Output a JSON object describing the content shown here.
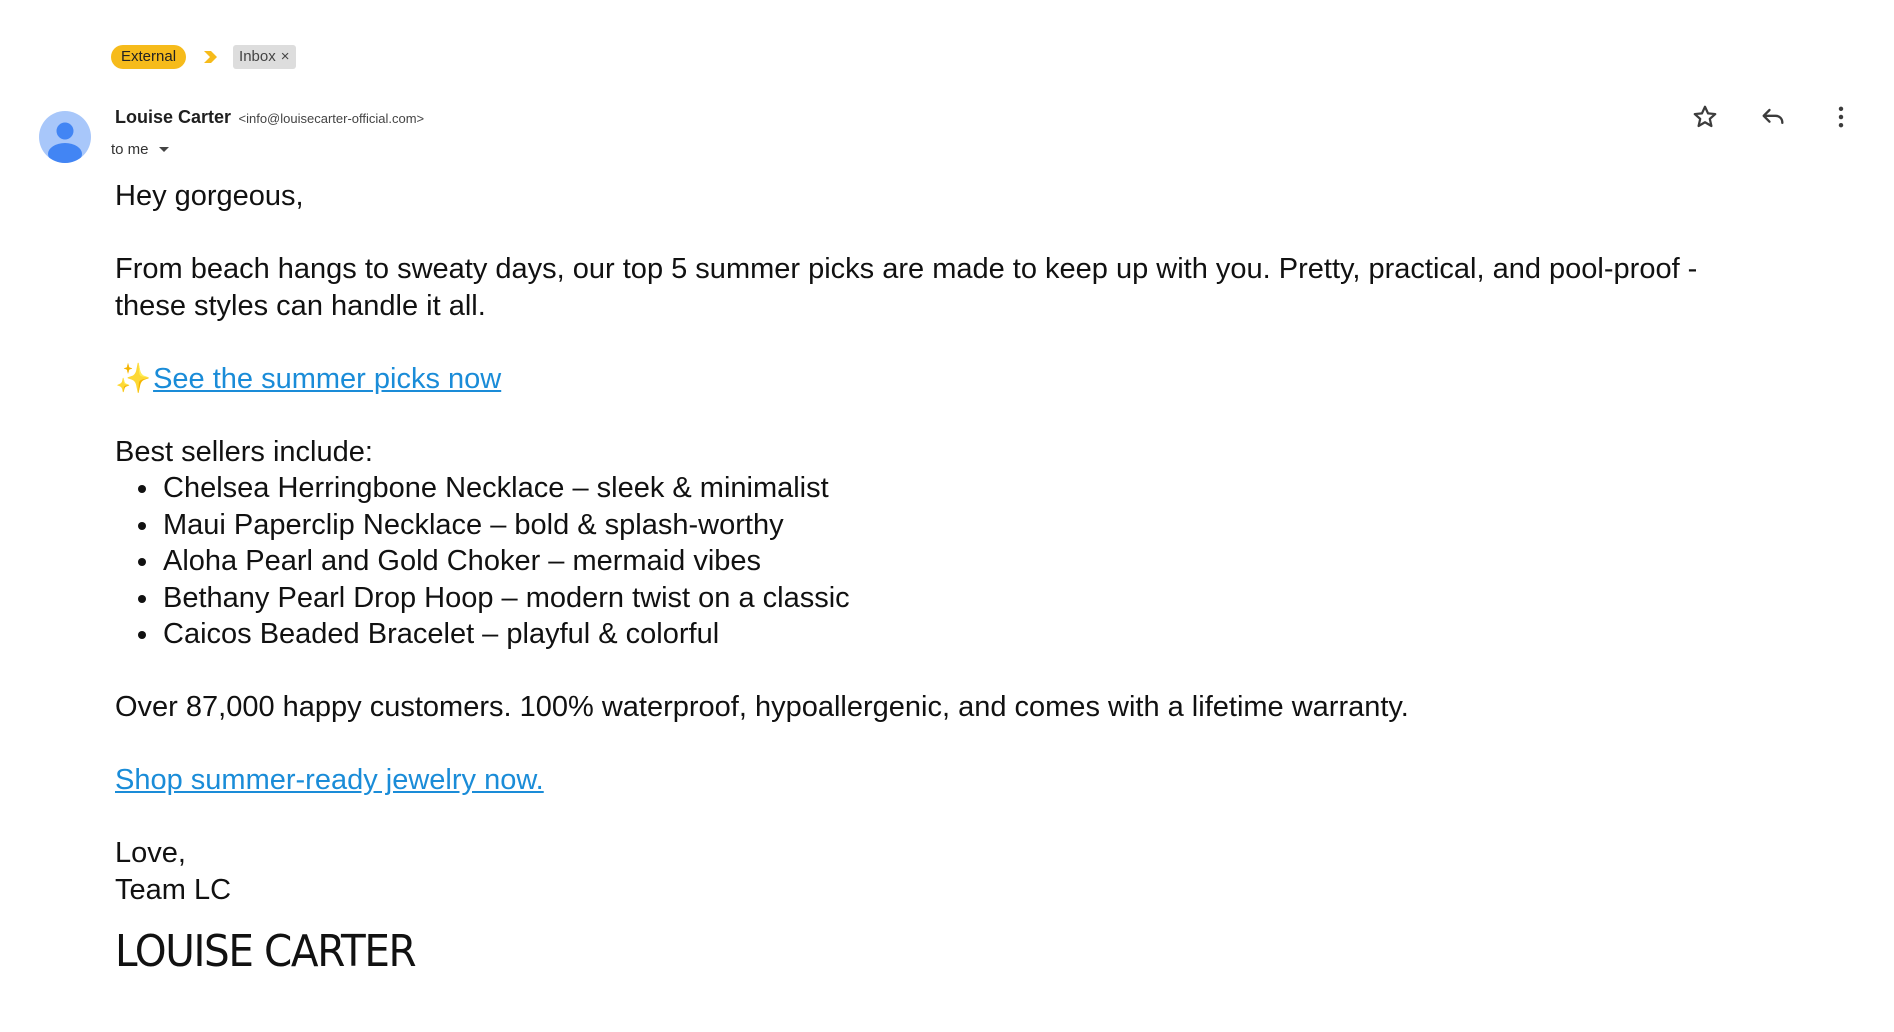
{
  "labels": {
    "external": "External",
    "inbox": "Inbox",
    "inbox_remove": "×"
  },
  "header": {
    "sender_name": "Louise Carter",
    "sender_email": "<info@louisecarter-official.com>",
    "recipient": "to me"
  },
  "icons": {
    "star": "star-icon",
    "reply": "reply-icon",
    "more": "more-vert-icon",
    "sparkle": "✨"
  },
  "body": {
    "greeting": "Hey gorgeous,",
    "intro": "From beach hangs to sweaty days, our top 5 summer picks are made to keep up with you. Pretty, practical, and pool-proof - these styles can handle it all.",
    "cta_link": "See the summer picks now",
    "best_sellers_heading": "Best sellers include:",
    "best_sellers": [
      "Chelsea Herringbone Necklace – sleek & minimalist",
      "Maui Paperclip Necklace – bold & splash-worthy",
      "Aloha Pearl and Gold Choker – mermaid vibes",
      "Bethany Pearl Drop Hoop – modern twist on a classic",
      "Caicos Beaded Bracelet – playful & colorful"
    ],
    "proof": "Over 87,000 happy customers. 100% waterproof, hypoallergenic, and comes with a lifetime warranty.",
    "shop_link": "Shop summer-ready jewelry now.",
    "signoff": "Love,",
    "signature": "Team LC",
    "brand": "LOUISE CARTER"
  },
  "colors": {
    "external_chip": "#f6bb1b",
    "inbox_chip": "#dddddd",
    "avatar_bg": "#a8c7fa",
    "avatar_fg": "#4285f4",
    "link": "#1a8cd8"
  }
}
